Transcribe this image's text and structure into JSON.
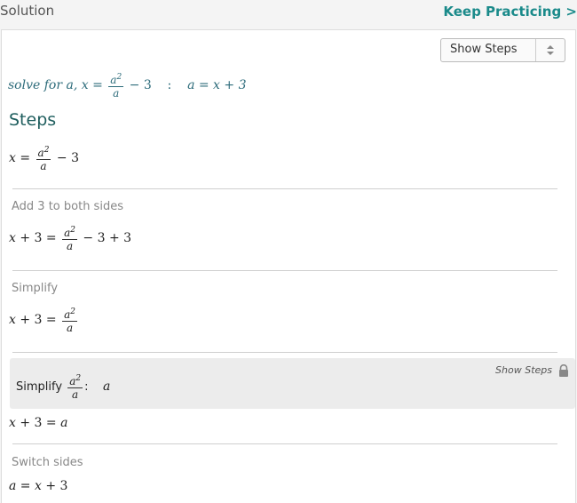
{
  "header": {
    "solution_label": "Solution",
    "keep_practicing": "Keep Practicing >"
  },
  "toolbar": {
    "show_steps_select": "Show Steps"
  },
  "problem": {
    "prefix": "solve for a,",
    "colon": ":",
    "answer": "a = x + 3"
  },
  "steps_title": "Steps",
  "steps": [
    {
      "desc": "Add 3 to both sides"
    },
    {
      "desc": "Simplify"
    },
    {
      "desc": "Switch sides"
    }
  ],
  "substep": {
    "label": "Simplify",
    "result": "a",
    "show_steps": "Show Steps",
    "icon": "lock-icon"
  },
  "colors": {
    "accent": "#1a8a8a",
    "heading": "#1f5e5e",
    "math_teal": "#2c6b7a"
  }
}
